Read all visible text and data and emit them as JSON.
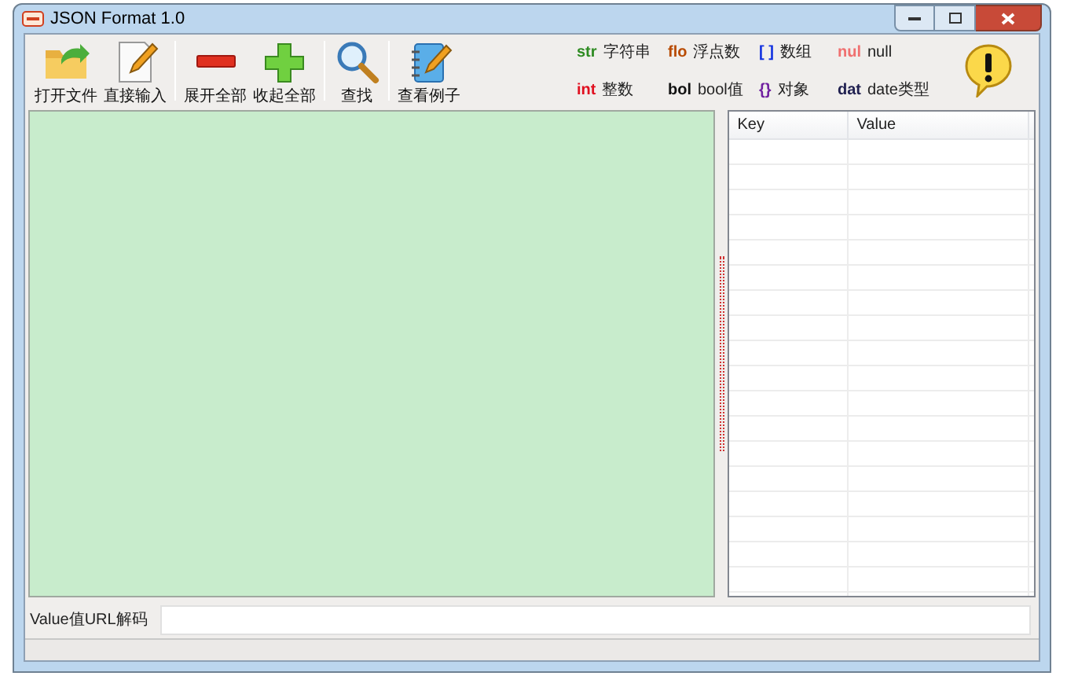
{
  "window": {
    "title": "JSON Format 1.0"
  },
  "toolbar": [
    {
      "label": "打开文件",
      "kind": "open"
    },
    {
      "label": "直接输入",
      "kind": "edit"
    },
    {
      "kind": "separator"
    },
    {
      "label": "展开全部",
      "kind": "minus"
    },
    {
      "label": "收起全部",
      "kind": "plus"
    },
    {
      "kind": "separator"
    },
    {
      "label": "查找",
      "kind": "search"
    },
    {
      "kind": "separator"
    },
    {
      "label": "查看例子",
      "kind": "notebook"
    }
  ],
  "legend": [
    {
      "tag": "str",
      "color": "#2e8b22",
      "label": "字符串"
    },
    {
      "tag": "flo",
      "color": "#b84a00",
      "label": "浮点数"
    },
    {
      "tag": "[ ]",
      "color": "#1030e0",
      "label": "数组"
    },
    {
      "tag": "nul",
      "color": "#f07070",
      "label": "null"
    },
    {
      "tag": "int",
      "color": "#e01020",
      "label": "整数"
    },
    {
      "tag": "bol",
      "color": "#111111",
      "label": "bool值"
    },
    {
      "tag": "{}",
      "color": "#7020a0",
      "label": "对象"
    },
    {
      "tag": "dat",
      "color": "#202050",
      "label": "date类型"
    }
  ],
  "table": {
    "columns": [
      "Key",
      "Value"
    ]
  },
  "url_decode": {
    "label": "Value值URL解码"
  }
}
